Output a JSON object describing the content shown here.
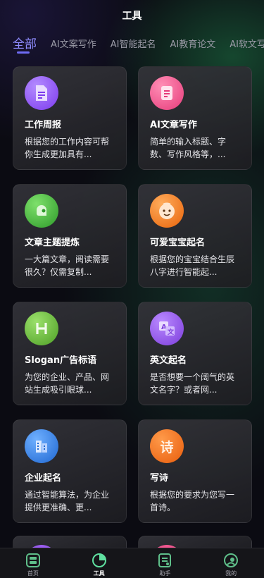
{
  "header": {
    "title": "工具"
  },
  "tabs": [
    {
      "label": "全部",
      "active": true
    },
    {
      "label": "AI文案写作",
      "active": false
    },
    {
      "label": "AI智能起名",
      "active": false
    },
    {
      "label": "AI教育论文",
      "active": false
    },
    {
      "label": "AI软文写",
      "active": false
    }
  ],
  "tools": [
    {
      "title": "工作周报",
      "desc": "根据您的工作内容可帮你生成更加具有...",
      "icon": "sheet-icon",
      "color": "#8b5cf6"
    },
    {
      "title": "AI文章写作",
      "desc": "简单的输入标题、字数、写作风格等，...",
      "icon": "document-icon",
      "color": "#f0568f"
    },
    {
      "title": "文章主题提炼",
      "desc": "一大篇文章，阅读需要很久？仅需复制...",
      "icon": "chat-bubble-icon",
      "color": "#3fae3a"
    },
    {
      "title": "可爱宝宝起名",
      "desc": "根据您的宝宝结合生辰八字进行智能起...",
      "icon": "baby-face-icon",
      "color": "#f27a1a"
    },
    {
      "title": "Slogan广告标语",
      "desc": "为您的企业、产品、网站生成吸引眼球...",
      "icon": "letter-h-icon",
      "color": "#62b43a"
    },
    {
      "title": "英文起名",
      "desc": "是否想要一个阔气的英文名字？或者网...",
      "icon": "translate-icon",
      "color": "#8e55e6"
    },
    {
      "title": "企业起名",
      "desc": "通过智能算法，为企业提供更准确、更...",
      "icon": "building-icon",
      "color": "#2f7fe0"
    },
    {
      "title": "写诗",
      "desc": "根据您的要求为您写一首诗。",
      "icon": "poem-icon",
      "color": "#f26d12",
      "glyph": "诗"
    }
  ],
  "peek_colors": [
    "#9a5cf0",
    "#f0568f"
  ],
  "bottom_nav": [
    {
      "label": "首页",
      "icon": "home-icon",
      "active": false
    },
    {
      "label": "工具",
      "icon": "tools-pie-icon",
      "active": true
    },
    {
      "label": "助手",
      "icon": "assistant-icon",
      "active": false
    },
    {
      "label": "我的",
      "icon": "profile-icon",
      "active": false
    }
  ]
}
